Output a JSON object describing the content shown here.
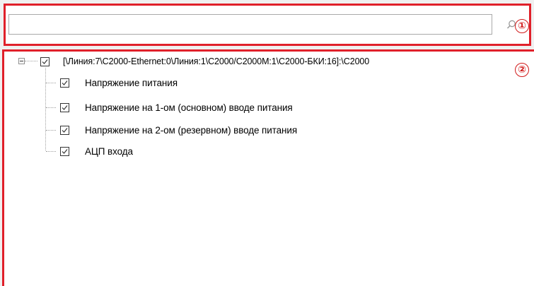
{
  "search": {
    "value": "",
    "placeholder": ""
  },
  "markers": {
    "one": "①",
    "two": "②"
  },
  "tree": {
    "root": {
      "label": "[\\Линия:7\\С2000-Ethernet:0\\Линия:1\\С2000/С2000М:1\\С2000-БКИ:16]:\\С2000",
      "checked": true,
      "expanded": true
    },
    "children": [
      {
        "label": "Напряжение питания",
        "checked": true
      },
      {
        "label": "Напряжение на 1-ом (основном) вводе питания",
        "checked": true
      },
      {
        "label": "Напряжение на 2-ом (резервном) вводе питания",
        "checked": true
      },
      {
        "label": "АЦП входа",
        "checked": true
      }
    ]
  },
  "colors": {
    "highlight": "#e0202a",
    "marker": "#d11a1a"
  }
}
